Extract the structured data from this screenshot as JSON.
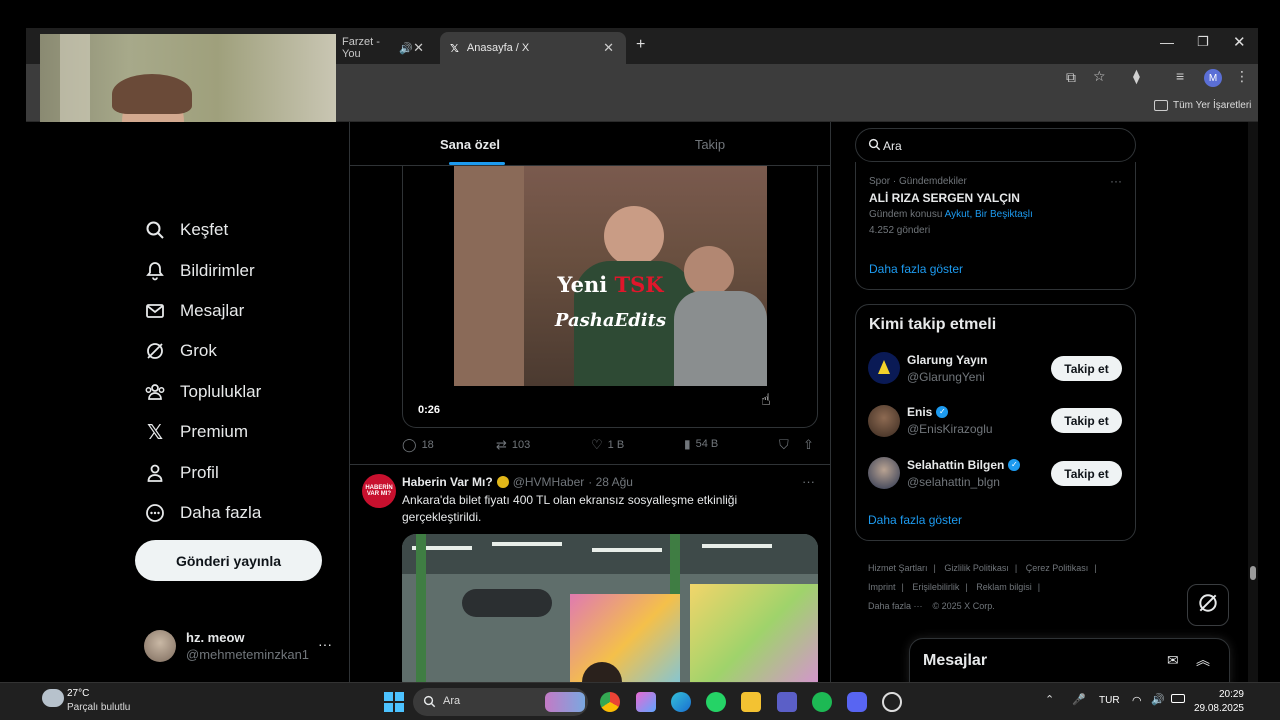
{
  "browser": {
    "tabs": [
      {
        "label": "Farzet - You"
      },
      {
        "label": "Anasayfa / X"
      }
    ],
    "bookmarks_label": "Tüm Yer İşaretleri",
    "profile_initial": "M"
  },
  "nav": {
    "items": [
      {
        "label": "Keşfet",
        "icon": "search-icon"
      },
      {
        "label": "Bildirimler",
        "icon": "bell-icon"
      },
      {
        "label": "Mesajlar",
        "icon": "mail-icon"
      },
      {
        "label": "Grok",
        "icon": "grok-icon"
      },
      {
        "label": "Topluluklar",
        "icon": "communities-icon"
      },
      {
        "label": "Premium",
        "icon": "x-logo-icon"
      },
      {
        "label": "Profil",
        "icon": "person-icon"
      },
      {
        "label": "Daha fazla",
        "icon": "more-circle-icon"
      }
    ],
    "post_button": "Gönderi yayınla",
    "account": {
      "name": "hz. meow",
      "handle": "@mehmeteminzkan1",
      "more": "···"
    }
  },
  "feed": {
    "tabs": {
      "active": "Sana özel",
      "other": "Takip"
    },
    "tweet1": {
      "video_overlay_line1_white": "Yeni ",
      "video_overlay_line1_red": "TSK",
      "video_overlay_line2": "PashaEdits",
      "video_time": "0:26",
      "replies": "18",
      "retweets": "103",
      "likes": "1 B",
      "views": "54 B"
    },
    "tweet2": {
      "avatar_text": "HABERİN VAR MI?",
      "name": "Haberin Var Mı?",
      "handle": "@HVMHaber",
      "date": "· 28 Ağu",
      "text": "Ankara'da bilet fiyatı 400 TL olan ekransız sosyalleşme etkinliği gerçekleştirildi.",
      "more": "···"
    }
  },
  "sidebar": {
    "search_placeholder": "Ara",
    "trend": {
      "category": "Spor · Gündemdekiler",
      "title": "ALİ RIZA SERGEN YALÇIN",
      "topic_prefix": "Gündem konusu",
      "topic_links": "Aykut, Bir Beşiktaşlı",
      "count": "4.252 gönderi",
      "more": "···",
      "show_more": "Daha fazla göster"
    },
    "who_to_follow": {
      "title": "Kimi takip etmeli",
      "users": [
        {
          "name": "Glarung Yayın",
          "handle": "@GlarungYeni",
          "verified": false,
          "button": "Takip et"
        },
        {
          "name": "Enis",
          "handle": "@EnisKirazoglu",
          "verified": true,
          "button": "Takip et"
        },
        {
          "name": "Selahattin Bilgen",
          "handle": "@selahattin_blgn",
          "verified": true,
          "button": "Takip et"
        }
      ],
      "show_more": "Daha fazla göster"
    },
    "footer": {
      "links": [
        "Hizmet Şartları",
        "Gizlilik Politikası",
        "Çerez Politikası",
        "Imprint",
        "Erişilebilirlik",
        "Reklam bilgisi"
      ],
      "more": "Daha fazla ···",
      "copyright": "© 2025 X Corp."
    },
    "messages_drawer": "Mesajlar"
  },
  "taskbar": {
    "weather_temp": "27°C",
    "weather_desc": "Parçalı bulutlu",
    "search_placeholder": "Ara",
    "lang": "TUR",
    "time": "20:29",
    "date": "29.08.2025"
  },
  "colors": {
    "accent": "#1d9bf0",
    "link": "#1d9bf0",
    "tsk_red": "#e0162b"
  }
}
